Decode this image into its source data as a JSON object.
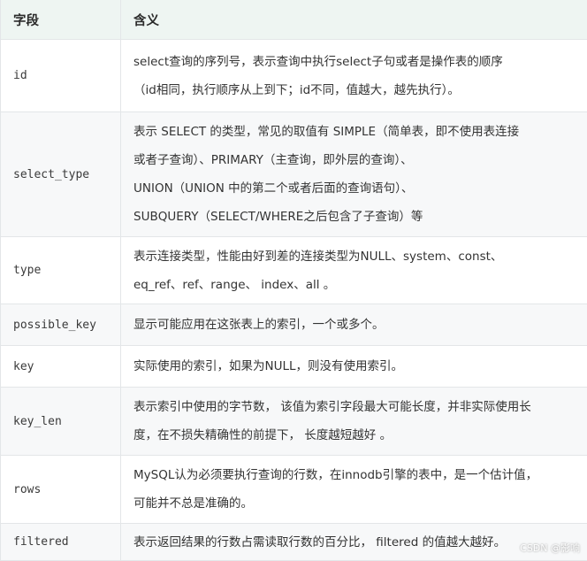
{
  "header": {
    "col1": "字段",
    "col2": "含义"
  },
  "rows": [
    {
      "field": "id",
      "lines": [
        "select查询的序列号，表示查询中执行select子句或者是操作表的顺序",
        "（id相同，执行顺序从上到下；id不同，值越大，越先执行）。"
      ]
    },
    {
      "field": "select_type",
      "lines": [
        "表示 SELECT 的类型，常见的取值有 SIMPLE（简单表，即不使用表连接",
        "或者子查询）、PRIMARY（主查询，即外层的查询）、",
        "UNION（UNION 中的第二个或者后面的查询语句）、",
        "SUBQUERY（SELECT/WHERE之后包含了子查询）等"
      ]
    },
    {
      "field": "type",
      "lines": [
        "表示连接类型，性能由好到差的连接类型为NULL、system、const、",
        "eq_ref、ref、range、 index、all 。"
      ]
    },
    {
      "field": "possible_key",
      "lines": [
        "显示可能应用在这张表上的索引，一个或多个。"
      ]
    },
    {
      "field": "key",
      "lines": [
        "实际使用的索引，如果为NULL，则没有使用索引。"
      ]
    },
    {
      "field": "key_len",
      "lines": [
        "表示索引中使用的字节数， 该值为索引字段最大可能长度，并非实际使用长",
        "度，在不损失精确性的前提下， 长度越短越好 。"
      ]
    },
    {
      "field": "rows",
      "lines": [
        "MySQL认为必须要执行查询的行数，在innodb引擎的表中，是一个估计值，",
        "可能并不总是准确的。"
      ]
    },
    {
      "field": "filtered",
      "lines": [
        "表示返回结果的行数占需读取行数的百分比， filtered 的值越大越好。"
      ]
    }
  ],
  "watermark": "CSDN @影响"
}
